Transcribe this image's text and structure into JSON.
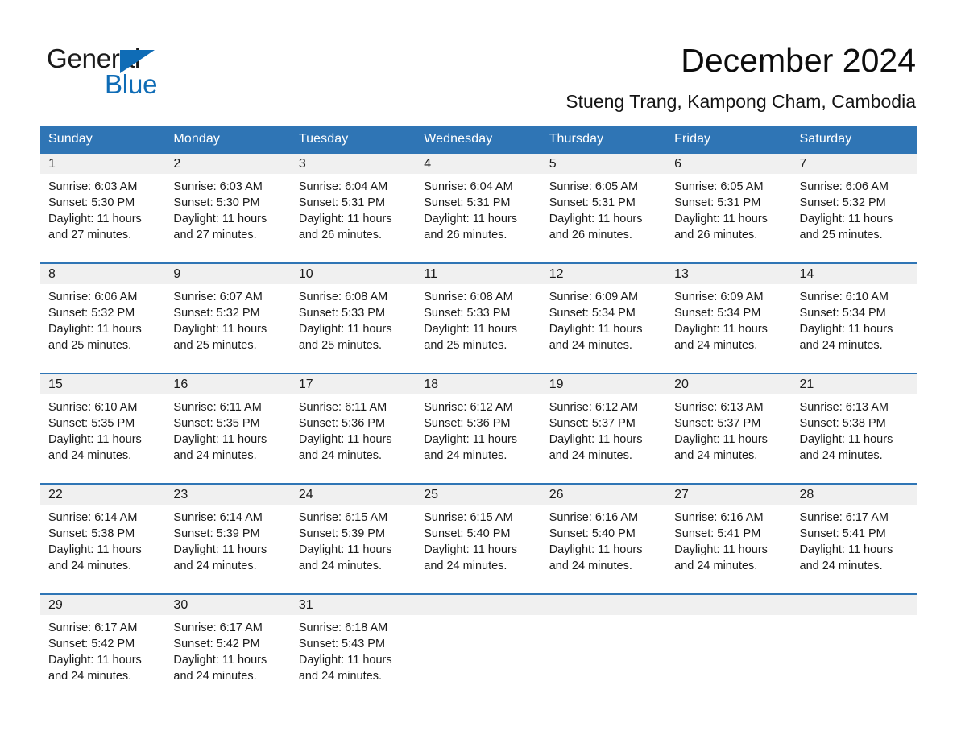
{
  "brand": {
    "name_part1": "General",
    "name_part2": "Blue"
  },
  "header": {
    "title": "December 2024",
    "subtitle": "Stueng Trang, Kampong Cham, Cambodia"
  },
  "colors": {
    "header_blue": "#2f75b5",
    "logo_blue": "#0f6cb6",
    "daynum_background": "#f0f0f0",
    "text": "#1a1a1a"
  },
  "calendar": {
    "weekday_headers": [
      "Sunday",
      "Monday",
      "Tuesday",
      "Wednesday",
      "Thursday",
      "Friday",
      "Saturday"
    ],
    "weeks": [
      [
        {
          "day": "1",
          "sunrise": "Sunrise: 6:03 AM",
          "sunset": "Sunset: 5:30 PM",
          "daylight": "Daylight: 11 hours and 27 minutes."
        },
        {
          "day": "2",
          "sunrise": "Sunrise: 6:03 AM",
          "sunset": "Sunset: 5:30 PM",
          "daylight": "Daylight: 11 hours and 27 minutes."
        },
        {
          "day": "3",
          "sunrise": "Sunrise: 6:04 AM",
          "sunset": "Sunset: 5:31 PM",
          "daylight": "Daylight: 11 hours and 26 minutes."
        },
        {
          "day": "4",
          "sunrise": "Sunrise: 6:04 AM",
          "sunset": "Sunset: 5:31 PM",
          "daylight": "Daylight: 11 hours and 26 minutes."
        },
        {
          "day": "5",
          "sunrise": "Sunrise: 6:05 AM",
          "sunset": "Sunset: 5:31 PM",
          "daylight": "Daylight: 11 hours and 26 minutes."
        },
        {
          "day": "6",
          "sunrise": "Sunrise: 6:05 AM",
          "sunset": "Sunset: 5:31 PM",
          "daylight": "Daylight: 11 hours and 26 minutes."
        },
        {
          "day": "7",
          "sunrise": "Sunrise: 6:06 AM",
          "sunset": "Sunset: 5:32 PM",
          "daylight": "Daylight: 11 hours and 25 minutes."
        }
      ],
      [
        {
          "day": "8",
          "sunrise": "Sunrise: 6:06 AM",
          "sunset": "Sunset: 5:32 PM",
          "daylight": "Daylight: 11 hours and 25 minutes."
        },
        {
          "day": "9",
          "sunrise": "Sunrise: 6:07 AM",
          "sunset": "Sunset: 5:32 PM",
          "daylight": "Daylight: 11 hours and 25 minutes."
        },
        {
          "day": "10",
          "sunrise": "Sunrise: 6:08 AM",
          "sunset": "Sunset: 5:33 PM",
          "daylight": "Daylight: 11 hours and 25 minutes."
        },
        {
          "day": "11",
          "sunrise": "Sunrise: 6:08 AM",
          "sunset": "Sunset: 5:33 PM",
          "daylight": "Daylight: 11 hours and 25 minutes."
        },
        {
          "day": "12",
          "sunrise": "Sunrise: 6:09 AM",
          "sunset": "Sunset: 5:34 PM",
          "daylight": "Daylight: 11 hours and 24 minutes."
        },
        {
          "day": "13",
          "sunrise": "Sunrise: 6:09 AM",
          "sunset": "Sunset: 5:34 PM",
          "daylight": "Daylight: 11 hours and 24 minutes."
        },
        {
          "day": "14",
          "sunrise": "Sunrise: 6:10 AM",
          "sunset": "Sunset: 5:34 PM",
          "daylight": "Daylight: 11 hours and 24 minutes."
        }
      ],
      [
        {
          "day": "15",
          "sunrise": "Sunrise: 6:10 AM",
          "sunset": "Sunset: 5:35 PM",
          "daylight": "Daylight: 11 hours and 24 minutes."
        },
        {
          "day": "16",
          "sunrise": "Sunrise: 6:11 AM",
          "sunset": "Sunset: 5:35 PM",
          "daylight": "Daylight: 11 hours and 24 minutes."
        },
        {
          "day": "17",
          "sunrise": "Sunrise: 6:11 AM",
          "sunset": "Sunset: 5:36 PM",
          "daylight": "Daylight: 11 hours and 24 minutes."
        },
        {
          "day": "18",
          "sunrise": "Sunrise: 6:12 AM",
          "sunset": "Sunset: 5:36 PM",
          "daylight": "Daylight: 11 hours and 24 minutes."
        },
        {
          "day": "19",
          "sunrise": "Sunrise: 6:12 AM",
          "sunset": "Sunset: 5:37 PM",
          "daylight": "Daylight: 11 hours and 24 minutes."
        },
        {
          "day": "20",
          "sunrise": "Sunrise: 6:13 AM",
          "sunset": "Sunset: 5:37 PM",
          "daylight": "Daylight: 11 hours and 24 minutes."
        },
        {
          "day": "21",
          "sunrise": "Sunrise: 6:13 AM",
          "sunset": "Sunset: 5:38 PM",
          "daylight": "Daylight: 11 hours and 24 minutes."
        }
      ],
      [
        {
          "day": "22",
          "sunrise": "Sunrise: 6:14 AM",
          "sunset": "Sunset: 5:38 PM",
          "daylight": "Daylight: 11 hours and 24 minutes."
        },
        {
          "day": "23",
          "sunrise": "Sunrise: 6:14 AM",
          "sunset": "Sunset: 5:39 PM",
          "daylight": "Daylight: 11 hours and 24 minutes."
        },
        {
          "day": "24",
          "sunrise": "Sunrise: 6:15 AM",
          "sunset": "Sunset: 5:39 PM",
          "daylight": "Daylight: 11 hours and 24 minutes."
        },
        {
          "day": "25",
          "sunrise": "Sunrise: 6:15 AM",
          "sunset": "Sunset: 5:40 PM",
          "daylight": "Daylight: 11 hours and 24 minutes."
        },
        {
          "day": "26",
          "sunrise": "Sunrise: 6:16 AM",
          "sunset": "Sunset: 5:40 PM",
          "daylight": "Daylight: 11 hours and 24 minutes."
        },
        {
          "day": "27",
          "sunrise": "Sunrise: 6:16 AM",
          "sunset": "Sunset: 5:41 PM",
          "daylight": "Daylight: 11 hours and 24 minutes."
        },
        {
          "day": "28",
          "sunrise": "Sunrise: 6:17 AM",
          "sunset": "Sunset: 5:41 PM",
          "daylight": "Daylight: 11 hours and 24 minutes."
        }
      ],
      [
        {
          "day": "29",
          "sunrise": "Sunrise: 6:17 AM",
          "sunset": "Sunset: 5:42 PM",
          "daylight": "Daylight: 11 hours and 24 minutes."
        },
        {
          "day": "30",
          "sunrise": "Sunrise: 6:17 AM",
          "sunset": "Sunset: 5:42 PM",
          "daylight": "Daylight: 11 hours and 24 minutes."
        },
        {
          "day": "31",
          "sunrise": "Sunrise: 6:18 AM",
          "sunset": "Sunset: 5:43 PM",
          "daylight": "Daylight: 11 hours and 24 minutes."
        },
        {
          "day": "",
          "sunrise": "",
          "sunset": "",
          "daylight": ""
        },
        {
          "day": "",
          "sunrise": "",
          "sunset": "",
          "daylight": ""
        },
        {
          "day": "",
          "sunrise": "",
          "sunset": "",
          "daylight": ""
        },
        {
          "day": "",
          "sunrise": "",
          "sunset": "",
          "daylight": ""
        }
      ]
    ]
  }
}
